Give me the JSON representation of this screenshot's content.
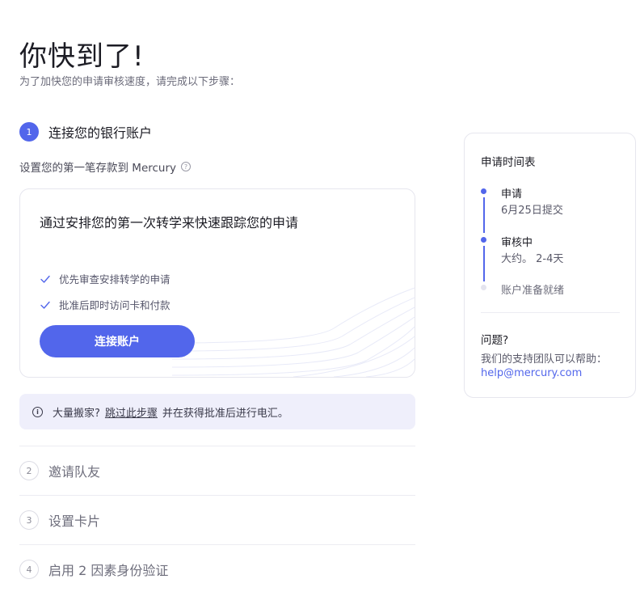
{
  "header": {
    "title": "你快到了!",
    "subtitle": "为了加快您的申请审核速度，请完成以下步骤："
  },
  "active_step": {
    "number": "1",
    "title": "连接您的银行账户",
    "description": "设置您的第一笔存款到 Mercury",
    "help_glyph": "?"
  },
  "card": {
    "title": "通过安排您的第一次转学来快速跟踪您的申请",
    "benefits": [
      "优先审查安排转学的申请",
      "批准后即时访问卡和付款"
    ],
    "button_label": "连接账户"
  },
  "notice": {
    "info_glyph": "i",
    "prefix": "大量搬家?",
    "link": "跳过此步骤",
    "suffix": "并在获得批准后进行电汇。"
  },
  "steps": [
    {
      "number": "2",
      "label": "邀请队友"
    },
    {
      "number": "3",
      "label": "设置卡片"
    },
    {
      "number": "4",
      "label": "启用 2 因素身份验证"
    }
  ],
  "timeline": {
    "heading": "申请时间表",
    "items": [
      {
        "label": "申请",
        "sub": "6月25日提交",
        "status": "done"
      },
      {
        "label": "审核中",
        "sub": "大约。 2-4天",
        "status": "active"
      },
      {
        "label": "账户准备就绪",
        "sub": "",
        "status": "pending"
      }
    ],
    "question_title": "问题?",
    "question_text": "我们的支持团队可以帮助：",
    "email": "help@mercury.com"
  },
  "colors": {
    "accent": "#5266eb",
    "notice_bg": "#efeffb",
    "pending_dot": "#e4e4ee"
  }
}
